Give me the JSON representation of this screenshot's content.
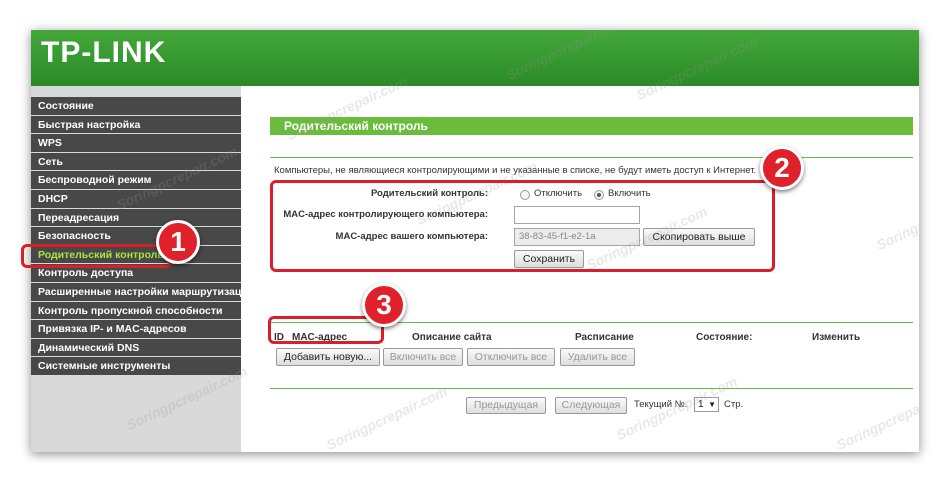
{
  "header": {
    "logo": "TP-LINK"
  },
  "sidebar": {
    "items": [
      {
        "label": "Состояние"
      },
      {
        "label": "Быстрая настройка"
      },
      {
        "label": "WPS"
      },
      {
        "label": "Сеть"
      },
      {
        "label": "Беспроводной режим"
      },
      {
        "label": "DHCP"
      },
      {
        "label": "Переадресация"
      },
      {
        "label": "Безопасность"
      },
      {
        "label": "Родительский контроль"
      },
      {
        "label": "Контроль доступа"
      },
      {
        "label": "Расширенные настройки маршрутизации"
      },
      {
        "label": "Контроль пропускной способности"
      },
      {
        "label": "Привязка IP- и MAC-адресов"
      },
      {
        "label": "Динамический DNS"
      },
      {
        "label": "Системные инструменты"
      }
    ]
  },
  "main": {
    "title": "Родительский контроль",
    "note": "Компьютеры, не являющиеся контролирующими и не указанные в списке, не будут иметь доступ к Интернет.",
    "form": {
      "parental_label": "Родительский контроль:",
      "disable_label": "Отключить",
      "enable_label": "Включить",
      "mac_control_label": "MAC-адрес контролирующего компьютера:",
      "mac_control_value": "",
      "mac_yours_label": "MAC-адрес вашего компьютера:",
      "mac_yours_value": "38-83-45-f1-e2-1a",
      "copy_button": "Скопировать выше",
      "save_button": "Сохранить"
    },
    "table": {
      "headers": [
        "ID",
        "MAC-адрес",
        "Описание сайта",
        "Расписание",
        "Состояние:",
        "Изменить"
      ]
    },
    "actions": {
      "add_new": "Добавить новую...",
      "enable_all": "Включить все",
      "disable_all": "Отключить все",
      "delete_all": "Удалить все"
    },
    "pager": {
      "prev": "Предыдущая",
      "next": "Следующая",
      "current_label": "Текущий №.",
      "current_value": "1",
      "page_label": "Стр."
    }
  },
  "callouts": {
    "one": "1",
    "two": "2",
    "three": "3"
  },
  "watermark": "Soringpcrepair.com",
  "colors": {
    "brand_green": "#2b8a27",
    "accent_green": "#6abd3c",
    "sidebar_dark": "#484848",
    "active_item": "#a8e63d",
    "callout_red": "#e0202a"
  }
}
